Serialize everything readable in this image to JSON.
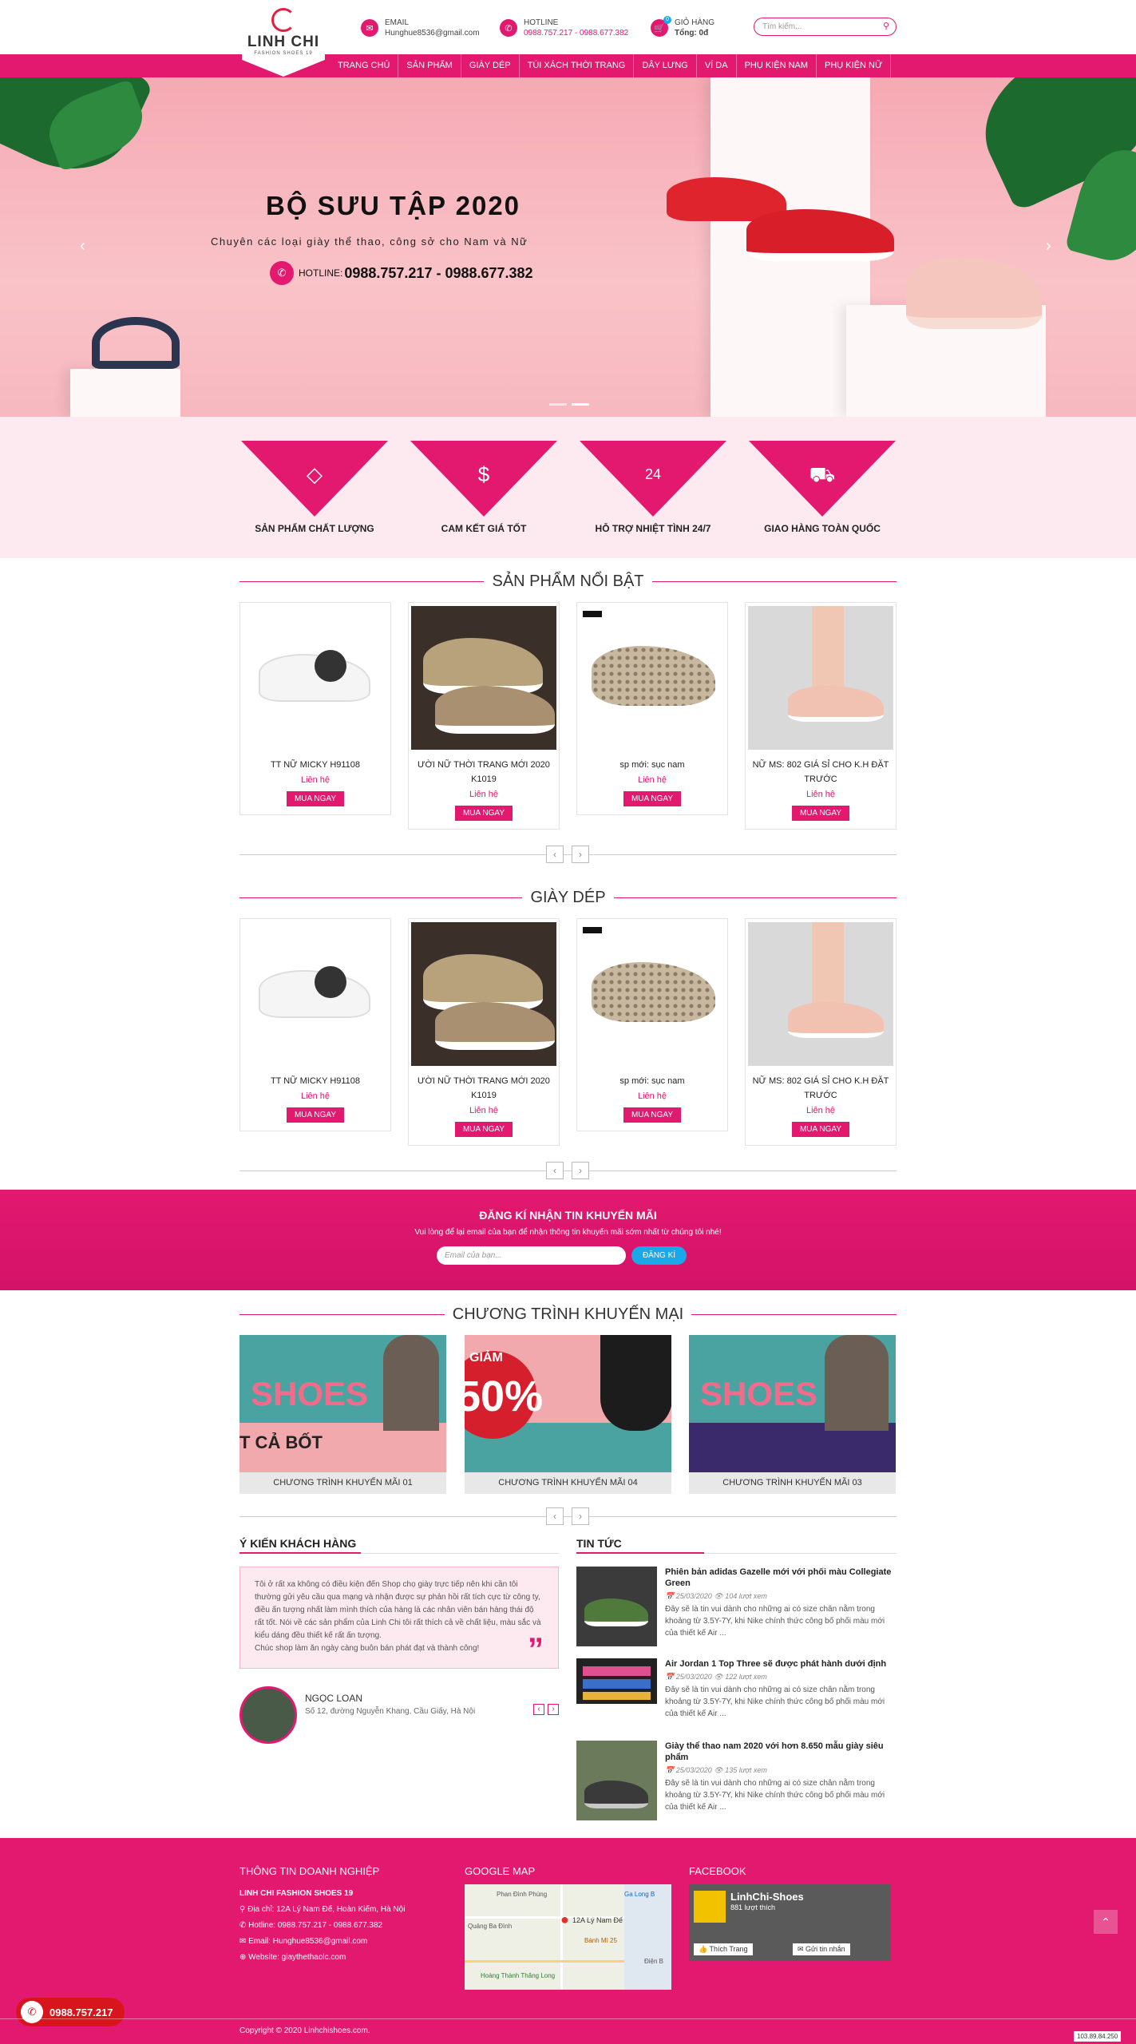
{
  "header": {
    "logo_name": "LINH CHI",
    "logo_sub": "FASHION SHOES 19",
    "email_label": "EMAIL",
    "email_value": "Hunghue8536@gmail.com",
    "hotline_label": "HOTLINE",
    "hotline_value": "0988.757.217 - 0988.677.382",
    "cart_label": "GIỎ HÀNG",
    "cart_total": "Tổng: 0đ",
    "cart_count": "0",
    "search_placeholder": "Tìm kiếm..."
  },
  "nav": [
    "TRANG CHỦ",
    "SẢN PHẨM",
    "GIÀY DÉP",
    "TÚI XÁCH THỜI TRANG",
    "DÂY LƯNG",
    "VÍ DA",
    "PHỤ KIỆN NAM",
    "PHỤ KIỆN NỮ"
  ],
  "banner": {
    "title": "BỘ SƯU TẬP 2020",
    "subtitle": "Chuyên các loại giày thể thao, công sở cho Nam và Nữ",
    "hotline_label": "HOTLINE:",
    "hotline_value": "0988.757.217 - 0988.677.382"
  },
  "features": [
    "SẢN PHẨM CHẤT LƯỢNG",
    "CAM KẾT GIÁ TỐT",
    "HỖ TRỢ NHIỆT TÌNH 24/7",
    "GIAO HÀNG TOÀN QUỐC"
  ],
  "featured": {
    "title": "SẢN PHẨM NỔI BẬT",
    "products": [
      {
        "name": "TT NỮ MICKY H91108",
        "price": "Liên hệ",
        "button": "MUA NGAY"
      },
      {
        "name": "ƯỜI NỮ THỜI TRANG MỚI 2020 K1019",
        "price": "Liên hệ",
        "button": "MUA NGAY"
      },
      {
        "name": "sp mới: sục nam",
        "price": "Liên hệ",
        "button": "MUA NGAY"
      },
      {
        "name": "NỮ MS: 802 GIÁ SỈ CHO K.H ĐẶT TRƯỚC",
        "price": "Liên hệ",
        "button": "MUA NGAY"
      }
    ]
  },
  "shoes": {
    "title": "GIÀY DÉP",
    "products": [
      {
        "name": "TT NỮ MICKY H91108",
        "price": "Liên hệ",
        "button": "MUA NGAY"
      },
      {
        "name": "ƯỜI NỮ THỜI TRANG MỚI 2020 K1019",
        "price": "Liên hệ",
        "button": "MUA NGAY"
      },
      {
        "name": "sp mới: sục nam",
        "price": "Liên hệ",
        "button": "MUA NGAY"
      },
      {
        "name": "NỮ MS: 802 GIÁ SỈ CHO K.H ĐẶT TRƯỚC",
        "price": "Liên hệ",
        "button": "MUA NGAY"
      }
    ]
  },
  "newsletter": {
    "title": "ĐĂNG KÍ NHẬN TIN KHUYẾN MÃI",
    "text": "Vui lòng để lại email của bạn để nhận thông tin khuyến mãi sớm nhất từ chúng tôi nhé!",
    "placeholder": "Email của bạn...",
    "button": "ĐĂNG KÍ"
  },
  "promo": {
    "title": "CHƯƠNG TRÌNH KHUYẾN MẠI",
    "items": [
      {
        "caption": "CHƯƠNG TRÌNH KHUYẾN MÃI 01",
        "big": "SHOES",
        "small": "T CẢ BỐT"
      },
      {
        "caption": "CHƯƠNG TRÌNH KHUYẾN MÃI 04",
        "big": "50%",
        "small": "GIẢM"
      },
      {
        "caption": "CHƯƠNG TRÌNH KHUYẾN MÃI 03",
        "big": "SHOES",
        "small": ""
      }
    ]
  },
  "testimonial": {
    "title": "Ý KIẾN KHÁCH HÀNG",
    "text": "Tôi ở rất xa không có điều kiện đến Shop chọ giày trực tiếp nên khi cần tôi thường gửi yêu cầu qua mạng và nhận được sự phản hồi rất tích cực từ công ty, điều ấn tượng nhất làm mình thích của hàng là các nhân viên bán hàng thái độ rất tốt. Nói về các sản phẩm của Linh Chi tôi rất thích cả về chất liệu, màu sắc và kiểu dáng đều thiết kế rất ấn tượng.",
    "text2": "Chúc shop làm ăn ngày càng buôn bán phát đạt và thành công!",
    "name": "NGỌC LOAN",
    "address": "Số 12, đường Nguyễn Khang, Cầu Giấy, Hà Nội"
  },
  "news": {
    "title": "TIN TỨC",
    "items": [
      {
        "title": "Phiên bản adidas Gazelle mới với phối màu Collegiate Green",
        "date": "25/03/2020",
        "views": "104 lượt xem",
        "desc": "Đây sẽ là tin vui dành cho những ai có size chân nằm trong khoảng từ 3.5Y-7Y, khi Nike chính thức công bố phối màu mới của thiết kế Air ..."
      },
      {
        "title": "Air Jordan 1 Top Three sẽ được phát hành dưới định",
        "date": "25/03/2020",
        "views": "122 lượt xem",
        "desc": "Đây sẽ là tin vui dành cho những ai có size chân nằm trong khoảng từ 3.5Y-7Y, khi Nike chính thức công bố phối màu mới của thiết kế Air ..."
      },
      {
        "title": "Giày thể thao nam 2020 với hơn 8.650 mẫu giày siêu phẩm",
        "date": "25/03/2020",
        "views": "135 lượt xem",
        "desc": "Đây sẽ là tin vui dành cho những ai có size chân nằm trong khoảng từ 3.5Y-7Y, khi Nike chính thức công bố phối màu mới của thiết kế Air ..."
      }
    ]
  },
  "footer": {
    "company_title": "THÔNG TIN DOANH NGHIỆP",
    "company_name": "LINH CHI FASHION SHOES 19",
    "address": "Địa chỉ: 12A Lý Nam Đế, Hoàn Kiếm, Hà Nội",
    "hotline": "Hotline: 0988.757.217 - 0988.677.382",
    "email": "Email: Hunghue8536@gmail.com",
    "website": "Website: giaythethaolc.com",
    "map_title": "GOOGLE MAP",
    "map_pin": "12A Lý Nam Đế",
    "map_labels": [
      "Phan Đình Phùng",
      "Quảng Ba Đình",
      "Bánh Mì 25",
      "Hoàng Thành Thăng Long",
      "Ga Long B",
      "Điện B"
    ],
    "fb_title": "FACEBOOK",
    "fb_page": "LinhChi-Shoes",
    "fb_likes": "881 lượt thích",
    "fb_like_btn": "Thích Trang",
    "fb_msg_btn": "Gửi tin nhắn",
    "copyright": "Copyright © 2020 Linhchishoes.com.",
    "phone_float": "0988.757.217",
    "ip": "103.89.84.250"
  },
  "colors": {
    "accent": "#e2196f",
    "newsletter_button": "#1aa8e8"
  }
}
